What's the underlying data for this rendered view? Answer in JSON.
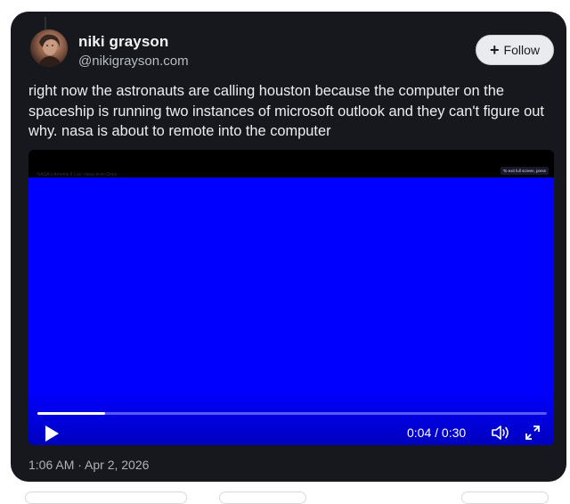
{
  "post": {
    "author": {
      "display_name": "niki grayson",
      "handle": "@nikigrayson.com",
      "avatar_icon": "profile-photo"
    },
    "follow_label": "Follow",
    "follow_icon": "+",
    "text": "right now the astronauts are calling houston because the computer on the spaceship is running two instances of microsoft outlook and they can't figure out why. nasa is about to remote into the computer",
    "timestamp": "1:06 AM · Apr 2, 2026"
  },
  "video": {
    "caption": "NASA's Artemis II Live Views from Orion",
    "fullscreen_hint": "To exit full screen, press",
    "fullscreen_hint_key": "",
    "current_time": "0:04",
    "duration": "0:30",
    "time_display": "0:04 / 0:30",
    "progress_fraction": 0.133,
    "screen_color": "#0000ff",
    "controls": {
      "play_icon": "play-icon",
      "volume_icon": "volume-icon",
      "fullscreen_icon": "fullscreen-icon"
    }
  },
  "colors": {
    "card_background": "#16181e",
    "text_primary": "#f2f3f5",
    "text_secondary": "#b8bcc4",
    "follow_button_bg": "#e9ebee"
  }
}
